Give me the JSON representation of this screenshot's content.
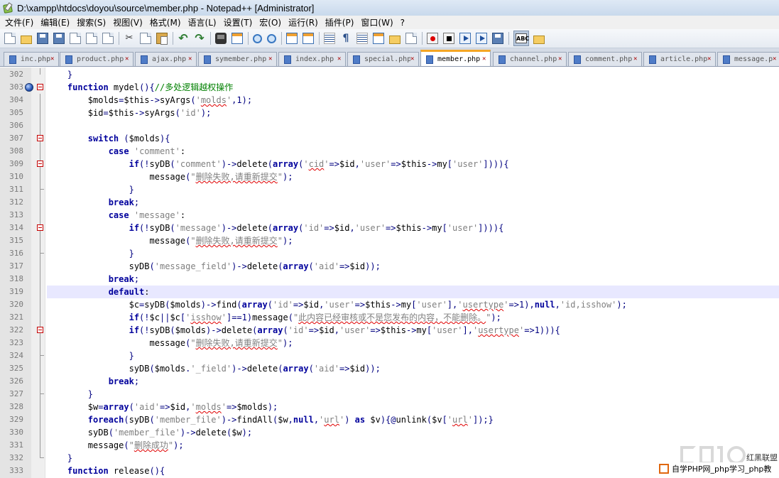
{
  "window": {
    "title": "D:\\xampp\\htdocs\\doyou\\source\\member.php - Notepad++ [Administrator]"
  },
  "menu": [
    "文件(F)",
    "编辑(E)",
    "搜索(S)",
    "视图(V)",
    "格式(M)",
    "语言(L)",
    "设置(T)",
    "宏(O)",
    "运行(R)",
    "插件(P)",
    "窗口(W)",
    "?"
  ],
  "toolbar": {
    "icons": [
      "new-file-icon",
      "open-file-icon",
      "save-icon",
      "save-all-icon",
      "close-icon",
      "close-all-icon",
      "print-icon",
      "cut-icon",
      "copy-icon",
      "paste-icon",
      "undo-icon",
      "redo-icon",
      "find-icon",
      "replace-icon",
      "zoom-in-icon",
      "zoom-out-icon",
      "sync-vertical-icon",
      "sync-horizontal-icon",
      "word-wrap-icon",
      "show-all-chars-icon",
      "indent-guide-icon",
      "user-language-icon",
      "doc-map-icon",
      "function-list-icon",
      "record-macro-icon",
      "stop-record-icon",
      "play-macro-icon",
      "run-macro-multiple-icon",
      "save-macro-icon",
      "spell-check-icon",
      "plugin-icon"
    ],
    "spell_label": "ABC"
  },
  "tabs": [
    {
      "label": "inc.php",
      "active": false
    },
    {
      "label": "product.php",
      "active": false
    },
    {
      "label": "ajax.php",
      "active": false
    },
    {
      "label": "symember.php",
      "active": false
    },
    {
      "label": "index.php",
      "active": false
    },
    {
      "label": "special.php",
      "active": false
    },
    {
      "label": "member.php",
      "active": true
    },
    {
      "label": "channel.php",
      "active": false
    },
    {
      "label": "comment.php",
      "active": false
    },
    {
      "label": "article.php",
      "active": false
    },
    {
      "label": "message.php",
      "active": false
    }
  ],
  "editor": {
    "current_line": 319,
    "lines": [
      {
        "n": "302",
        "t": "    }"
      },
      {
        "n": "303",
        "t": "    function mydel(){//多处逻辑越权操作"
      },
      {
        "n": "304",
        "t": "        $molds=$this->syArgs('molds',1);"
      },
      {
        "n": "305",
        "t": "        $id=$this->syArgs('id');"
      },
      {
        "n": "306",
        "t": ""
      },
      {
        "n": "307",
        "t": "        switch ($molds){"
      },
      {
        "n": "308",
        "t": "            case 'comment':"
      },
      {
        "n": "309",
        "t": "                if(!syDB('comment')->delete(array('cid'=>$id,'user'=>$this->my['user']))){"
      },
      {
        "n": "310",
        "t": "                    message(\"删除失败,请重新提交\");"
      },
      {
        "n": "311",
        "t": "                }"
      },
      {
        "n": "312",
        "t": "            break;"
      },
      {
        "n": "313",
        "t": "            case 'message':"
      },
      {
        "n": "314",
        "t": "                if(!syDB('message')->delete(array('id'=>$id,'user'=>$this->my['user']))){"
      },
      {
        "n": "315",
        "t": "                    message(\"删除失败,请重新提交\");"
      },
      {
        "n": "316",
        "t": "                }"
      },
      {
        "n": "317",
        "t": "                syDB('message_field')->delete(array('aid'=>$id));"
      },
      {
        "n": "318",
        "t": "            break;"
      },
      {
        "n": "319",
        "t": "            default:"
      },
      {
        "n": "320",
        "t": "                $c=syDB($molds)->find(array('id'=>$id,'user'=>$this->my['user'],'usertype'=>1),null,'id,isshow');"
      },
      {
        "n": "321",
        "t": "                if(!$c||$c['isshow']==1)message(\"此内容已经审核或不是您发布的内容，不能删除。\");"
      },
      {
        "n": "322",
        "t": "                if(!syDB($molds)->delete(array('id'=>$id,'user'=>$this->my['user'],'usertype'=>1))){"
      },
      {
        "n": "323",
        "t": "                    message(\"删除失败,请重新提交\");"
      },
      {
        "n": "324",
        "t": "                }"
      },
      {
        "n": "325",
        "t": "                syDB($molds.'_field')->delete(array('aid'=>$id));"
      },
      {
        "n": "326",
        "t": "            break;"
      },
      {
        "n": "327",
        "t": "        }"
      },
      {
        "n": "328",
        "t": "        $w=array('aid'=>$id,'molds'=>$molds);"
      },
      {
        "n": "329",
        "t": "        foreach(syDB('member_file')->findAll($w,null,'url') as $v){@unlink($v['url']);}"
      },
      {
        "n": "330",
        "t": "        syDB('member_file')->delete($w);"
      },
      {
        "n": "331",
        "t": "        message(\"删除成功\");"
      },
      {
        "n": "332",
        "t": "    }"
      },
      {
        "n": "333",
        "t": "    function release(){"
      }
    ]
  },
  "watermark": {
    "brand": "红黑联盟",
    "bar_text": "自学PHP网_php学习_php教"
  }
}
